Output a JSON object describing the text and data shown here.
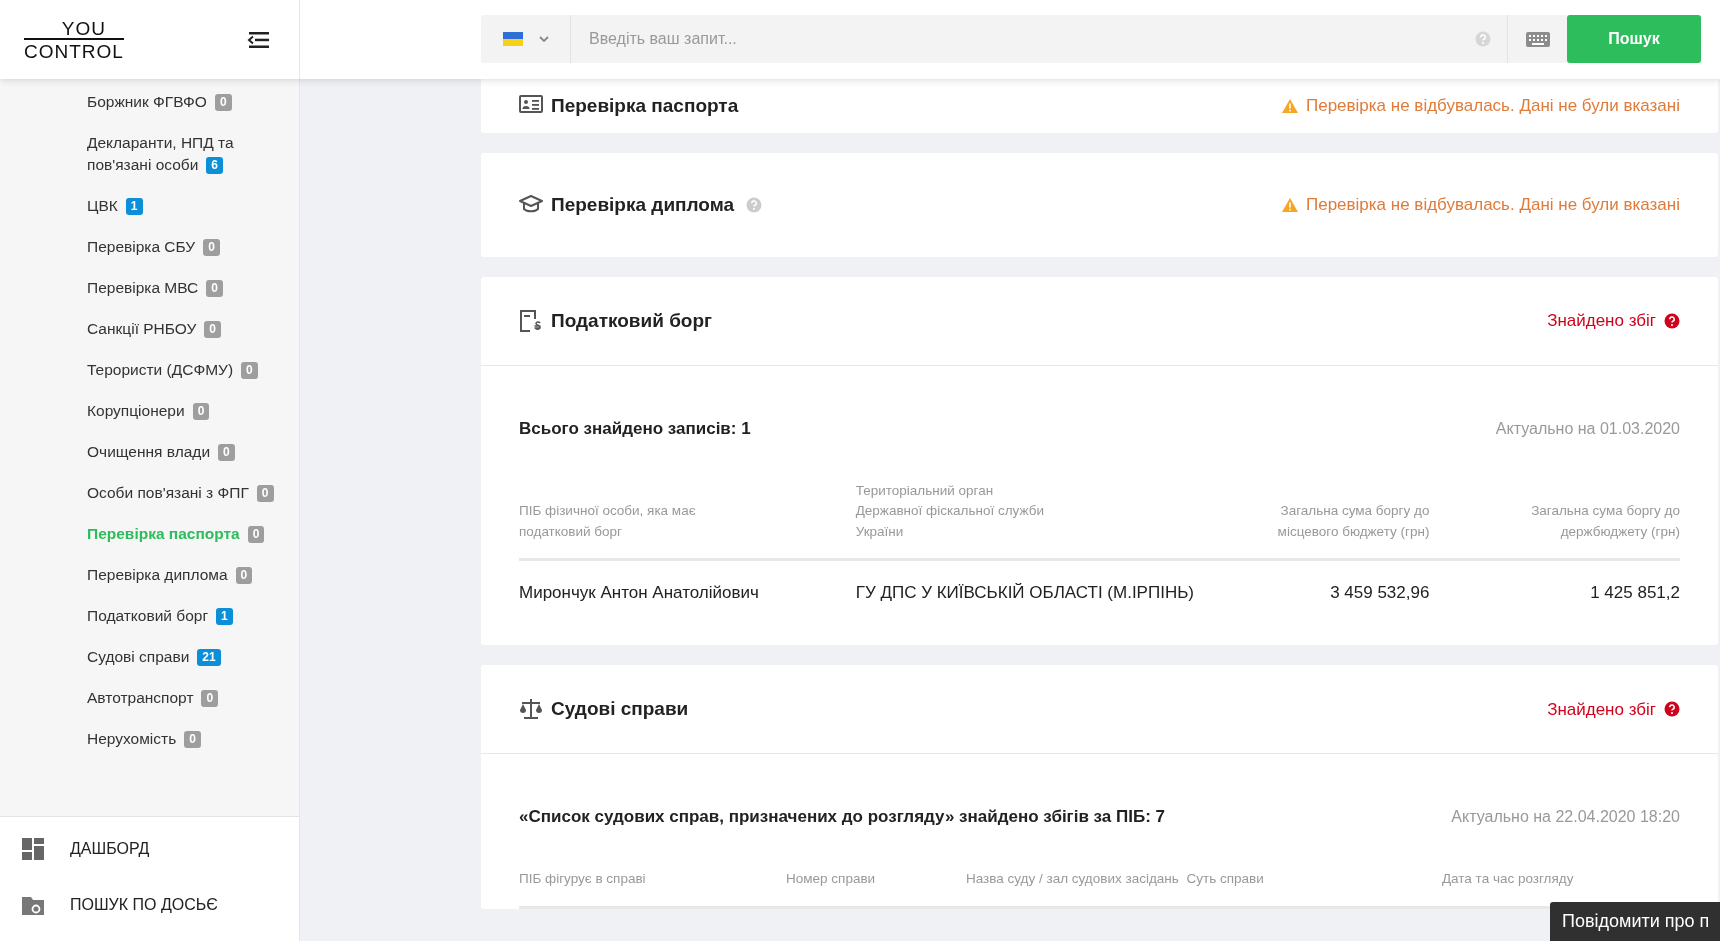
{
  "header": {
    "logo_top": "YOU",
    "logo_bottom": "CONTROL",
    "search": {
      "placeholder": "Введіть ваш запит..."
    },
    "search_button": "Пошук"
  },
  "sidebar": {
    "items": [
      {
        "label": "Боржник ФГВФО",
        "count": "0",
        "color": "#9e9e9e",
        "selected": false
      },
      {
        "label": "Декларанти, НПД та пов'язані особи",
        "count": "6",
        "color": "#0a8fd8",
        "selected": false
      },
      {
        "label": "ЦВК",
        "count": "1",
        "color": "#0a8fd8",
        "selected": false
      },
      {
        "label": "Перевірка СБУ",
        "count": "0",
        "color": "#9e9e9e",
        "selected": false
      },
      {
        "label": "Перевірка МВС",
        "count": "0",
        "color": "#9e9e9e",
        "selected": false
      },
      {
        "label": "Санкції РНБОУ",
        "count": "0",
        "color": "#9e9e9e",
        "selected": false
      },
      {
        "label": "Терористи (ДСФМУ)",
        "count": "0",
        "color": "#9e9e9e",
        "selected": false
      },
      {
        "label": "Корупціонери",
        "count": "0",
        "color": "#9e9e9e",
        "selected": false
      },
      {
        "label": "Очищення влади",
        "count": "0",
        "color": "#9e9e9e",
        "selected": false
      },
      {
        "label": "Особи пов'язані з ФПГ",
        "count": "0",
        "color": "#9e9e9e",
        "selected": false
      },
      {
        "label": "Перевірка паспорта",
        "count": "0",
        "color": "#9e9e9e",
        "selected": true
      },
      {
        "label": "Перевірка диплома",
        "count": "0",
        "color": "#9e9e9e",
        "selected": false
      },
      {
        "label": "Податковий борг",
        "count": "1",
        "color": "#0a8fd8",
        "selected": false
      },
      {
        "label": "Судові справи",
        "count": "21",
        "color": "#0a8fd8",
        "selected": false
      },
      {
        "label": "Автотранспорт",
        "count": "0",
        "color": "#9e9e9e",
        "selected": false
      },
      {
        "label": "Нерухомість",
        "count": "0",
        "color": "#9e9e9e",
        "selected": false
      }
    ],
    "nav": [
      {
        "kind": "dashboard",
        "label": "ДАШБОРД"
      },
      {
        "kind": "folder",
        "label": "ПОШУК ПО ДОСЬЄ"
      }
    ]
  },
  "sections": [
    {
      "kind": "passport",
      "title": "Перевірка паспорта",
      "help": false,
      "found": false,
      "status": "Перевірка не відбувалась. Дані не були вказані"
    },
    {
      "kind": "diploma",
      "title": "Перевірка диплома",
      "help": true,
      "found": false,
      "status": "Перевірка не відбувалась. Дані не були вказані"
    },
    {
      "kind": "tax",
      "title": "Податковий борг",
      "help": false,
      "found": true,
      "status": "Знайдено збіг",
      "summary": "Всього знайдено записів: 1",
      "updated": "Актуально на 01.03.2020",
      "table": {
        "columns": [
          "ПІБ фізичної особи, яка має податковий борг",
          "Територіальний орган Державної фіскальної служби України",
          "Загальна сума боргу до місцевого бюджету (грн)",
          "Загальна сума боргу до держбюджету (грн)"
        ],
        "rows": [
          [
            "Мирончук Антон Анатолійович",
            "ГУ ДПС У КИЇВСЬКІЙ ОБЛАСТІ (М.ІРПІНЬ)",
            "3 459 532,96",
            "1 425 851,2"
          ]
        ]
      }
    },
    {
      "kind": "court",
      "title": "Судові справи",
      "help": false,
      "found": true,
      "status": "Знайдено збіг",
      "summary": "«Список судових справ, призначених до розгляду» знайдено збігів за ПІБ: 7",
      "updated": "Актуально на 22.04.2020 18:20",
      "table": {
        "columns": [
          "ПІБ фігурує в справі",
          "Номер справи",
          "Назва суду / зал судових засідань",
          "Суть справи",
          "Дата та час розгляду"
        ]
      }
    }
  ],
  "feedback_button": "Повідомити про п"
}
